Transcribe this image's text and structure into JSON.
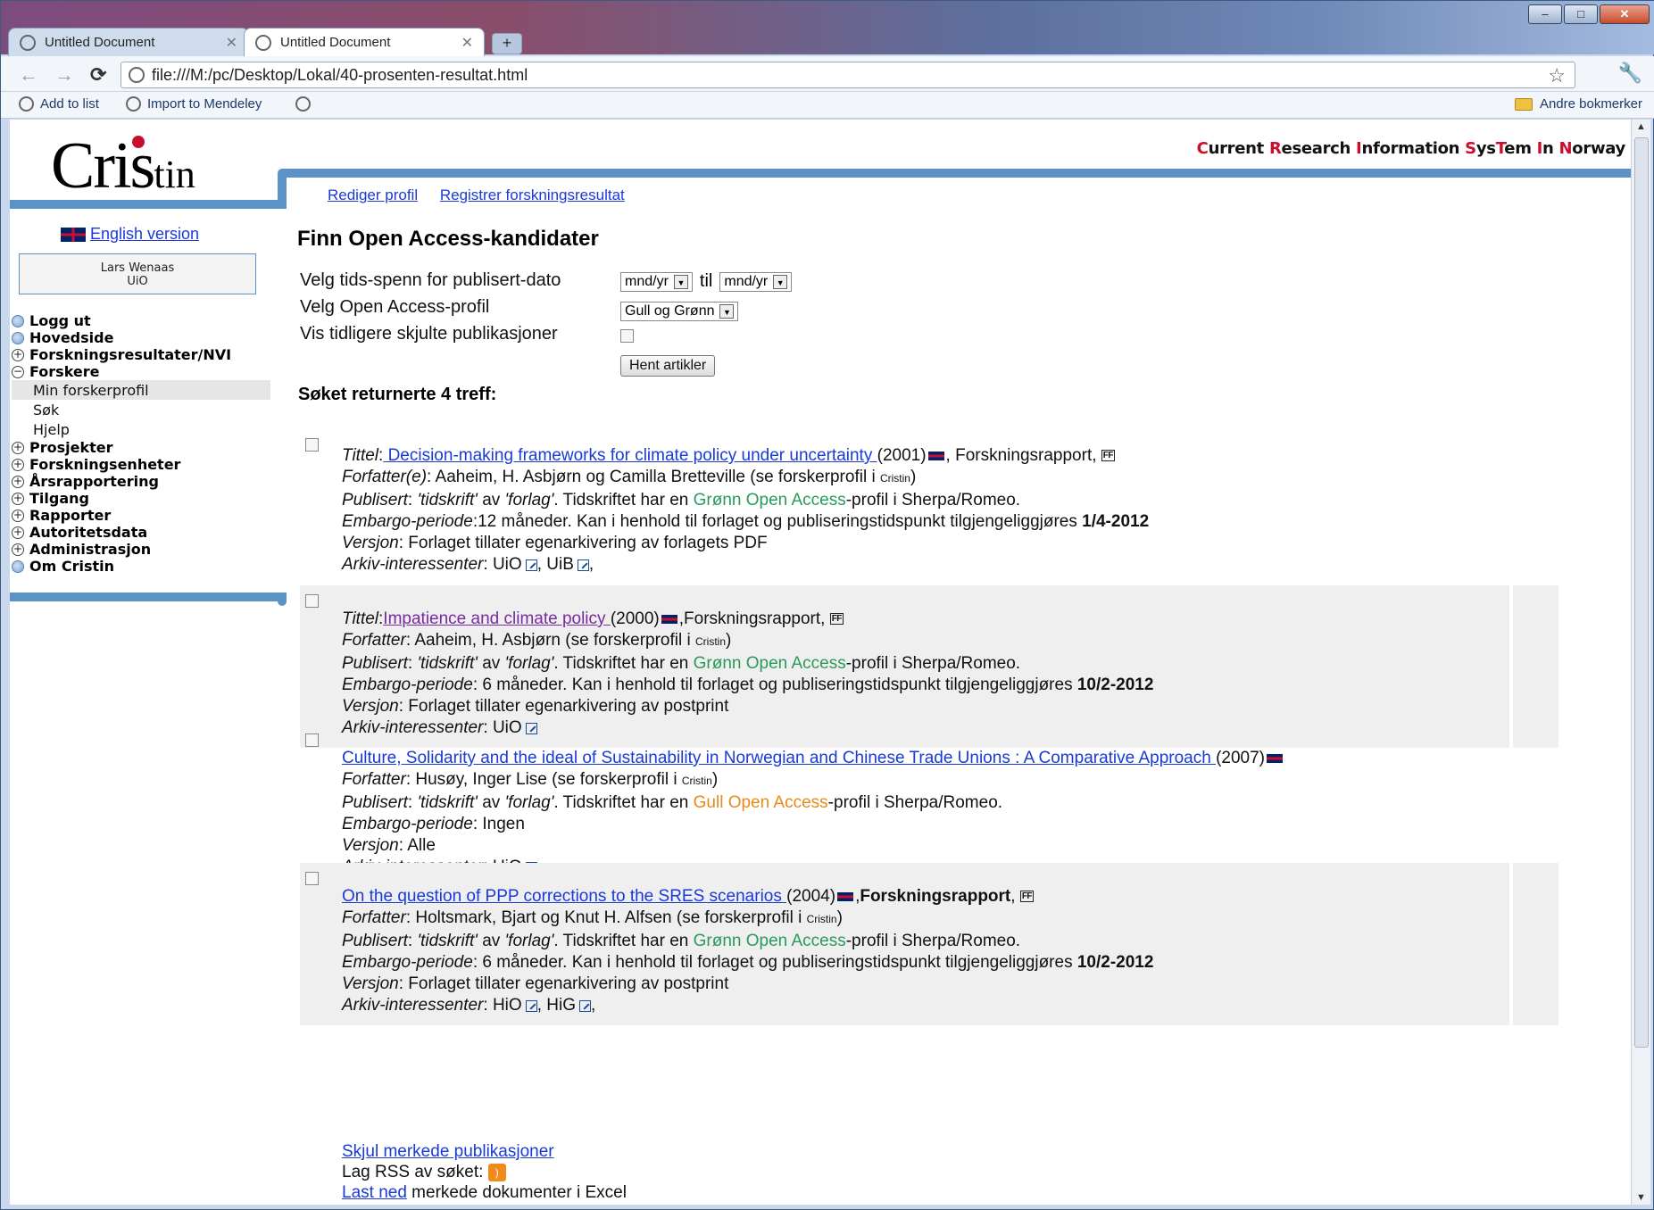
{
  "browser": {
    "tabs": [
      {
        "label": "Untitled Document",
        "active": false
      },
      {
        "label": "Untitled Document",
        "active": true
      }
    ],
    "url": "file:///M:/pc/Desktop/Lokal/40-prosenten-resultat.html",
    "bookmarks": [
      {
        "label": "Add to list"
      },
      {
        "label": "Import to Mendeley"
      }
    ],
    "other_bookmarks": "Andre bokmerker"
  },
  "site": {
    "logo_big": "Cris",
    "logo_small": "tin",
    "tagline": [
      {
        "t": "C",
        "red": true
      },
      {
        "t": "urrent ",
        "red": false
      },
      {
        "t": "R",
        "red": true
      },
      {
        "t": "esearch ",
        "red": false
      },
      {
        "t": "I",
        "red": true
      },
      {
        "t": "nformation ",
        "red": false
      },
      {
        "t": "S",
        "red": true
      },
      {
        "t": "ys",
        "red": false
      },
      {
        "t": "T",
        "red": true
      },
      {
        "t": "em ",
        "red": false
      },
      {
        "t": "I",
        "red": true
      },
      {
        "t": "n ",
        "red": false
      },
      {
        "t": "N",
        "red": true
      },
      {
        "t": "orway",
        "red": false
      }
    ]
  },
  "sidebar": {
    "english": "English version",
    "user_name": "Lars Wenaas",
    "user_org": "UiO",
    "menu": [
      {
        "label": "Logg ut",
        "icon": "dot"
      },
      {
        "label": "Hovedside",
        "icon": "dot"
      },
      {
        "label": "Forskningsresultater/NVI",
        "icon": "plus"
      },
      {
        "label": "Forskere",
        "icon": "minus"
      },
      {
        "label": "Min forskerprofil",
        "sub": true,
        "selected": true
      },
      {
        "label": "Søk",
        "sub": true
      },
      {
        "label": "Hjelp",
        "sub": true
      },
      {
        "label": "Prosjekter",
        "icon": "plus"
      },
      {
        "label": "Forskningsenheter",
        "icon": "plus"
      },
      {
        "label": "Årsrapportering",
        "icon": "plus"
      },
      {
        "label": "Tilgang",
        "icon": "plus"
      },
      {
        "label": "Rapporter",
        "icon": "plus"
      },
      {
        "label": "Autoritetsdata",
        "icon": "plus"
      },
      {
        "label": "Administrasjon",
        "icon": "plus"
      },
      {
        "label": "Om Cristin",
        "icon": "dot"
      }
    ]
  },
  "main": {
    "links": [
      "Rediger profil",
      "Registrer forskningsresultat"
    ],
    "title": "Finn Open Access-kandidater",
    "form": {
      "time_label": "Velg tids-spenn for publisert-dato",
      "from": "mnd/yr",
      "til": "til",
      "to": "mnd/yr",
      "profile_label": "Velg Open Access-profil",
      "profile_value": "Gull og Grønn",
      "hidden_label": "Vis tidligere skjulte publikasjoner",
      "fetch": "Hent artikler"
    },
    "result_count": "Søket returnerte 4 treff:",
    "labels": {
      "tittel": "Tittel",
      "forfatter": "Forfatter",
      "forfatter_e": "Forfatter(e)",
      "publisert": "Publisert",
      "embargo": "Embargo-periode",
      "versjon": "Versjon",
      "arkiv": "Arkiv-interessenter",
      "profile_suffix": "-profil i Sherpa/Romeo.",
      "kan": ". Kan i henhold til forlaget og publiseringstidspunkt tilgjengeliggjøres ",
      "published_text": "'tidskrift'",
      "forlag_text": "'forlag'",
      "tidskriftet": ". Tidskriftet har en ",
      "av": " av ",
      "se": " (se forskerprofil i ",
      "cris_small": "Cristin",
      "close_paren": ")"
    },
    "results": [
      {
        "title": " Decision-making frameworks for climate policy under uncertainty ",
        "year": "(2001)",
        "type": "Forskningsrapport",
        "authors": "Aaheim, H. Asbjørn og Camilla Bretteville",
        "oa": "Grønn Open Access",
        "oa_color": "green",
        "embargo": "12 måneder",
        "date": "1/4-2012",
        "version": "Forlaget tillater egenarkivering av forlagets PDF",
        "archives": "UiO, UiB"
      },
      {
        "title": "Impatience and climate policy ",
        "year": "(2000)",
        "type": "Forskningsrapport",
        "authors": "Aaheim, H. Asbjørn",
        "oa": "Grønn Open Access",
        "oa_color": "green",
        "embargo": " 6 måneder",
        "date": "10/2-2012",
        "version": "Forlaget tillater egenarkivering av postprint",
        "archives": "UiO"
      },
      {
        "title": "Culture, Solidarity and the ideal of Sustainability in Norwegian and Chinese Trade Unions : A Comparative Approach ",
        "year": "(2007)",
        "authors": "Husøy, Inger Lise",
        "oa": "Gull Open Access",
        "oa_color": "gold",
        "embargo": " Ingen",
        "version": "Alle",
        "archives": "UiO"
      },
      {
        "title": "On the question of PPP corrections to the SRES scenarios ",
        "year": "(2004)",
        "type": "Forskningsrapport",
        "authors": "Holtsmark, Bjart og Knut H. Alfsen",
        "oa": "Grønn Open Access",
        "oa_color": "green",
        "embargo": " 6 måneder",
        "date": "10/2-2012",
        "version": "Forlaget tillater egenarkivering av postprint",
        "archives": "HiO, HiG"
      }
    ],
    "footer": {
      "hide": "Skjul merkede publikasjoner",
      "rss": "Lag RSS av søket:",
      "download_link": "Last ned",
      "download_rest": " merkede dokumenter i Excel"
    }
  }
}
